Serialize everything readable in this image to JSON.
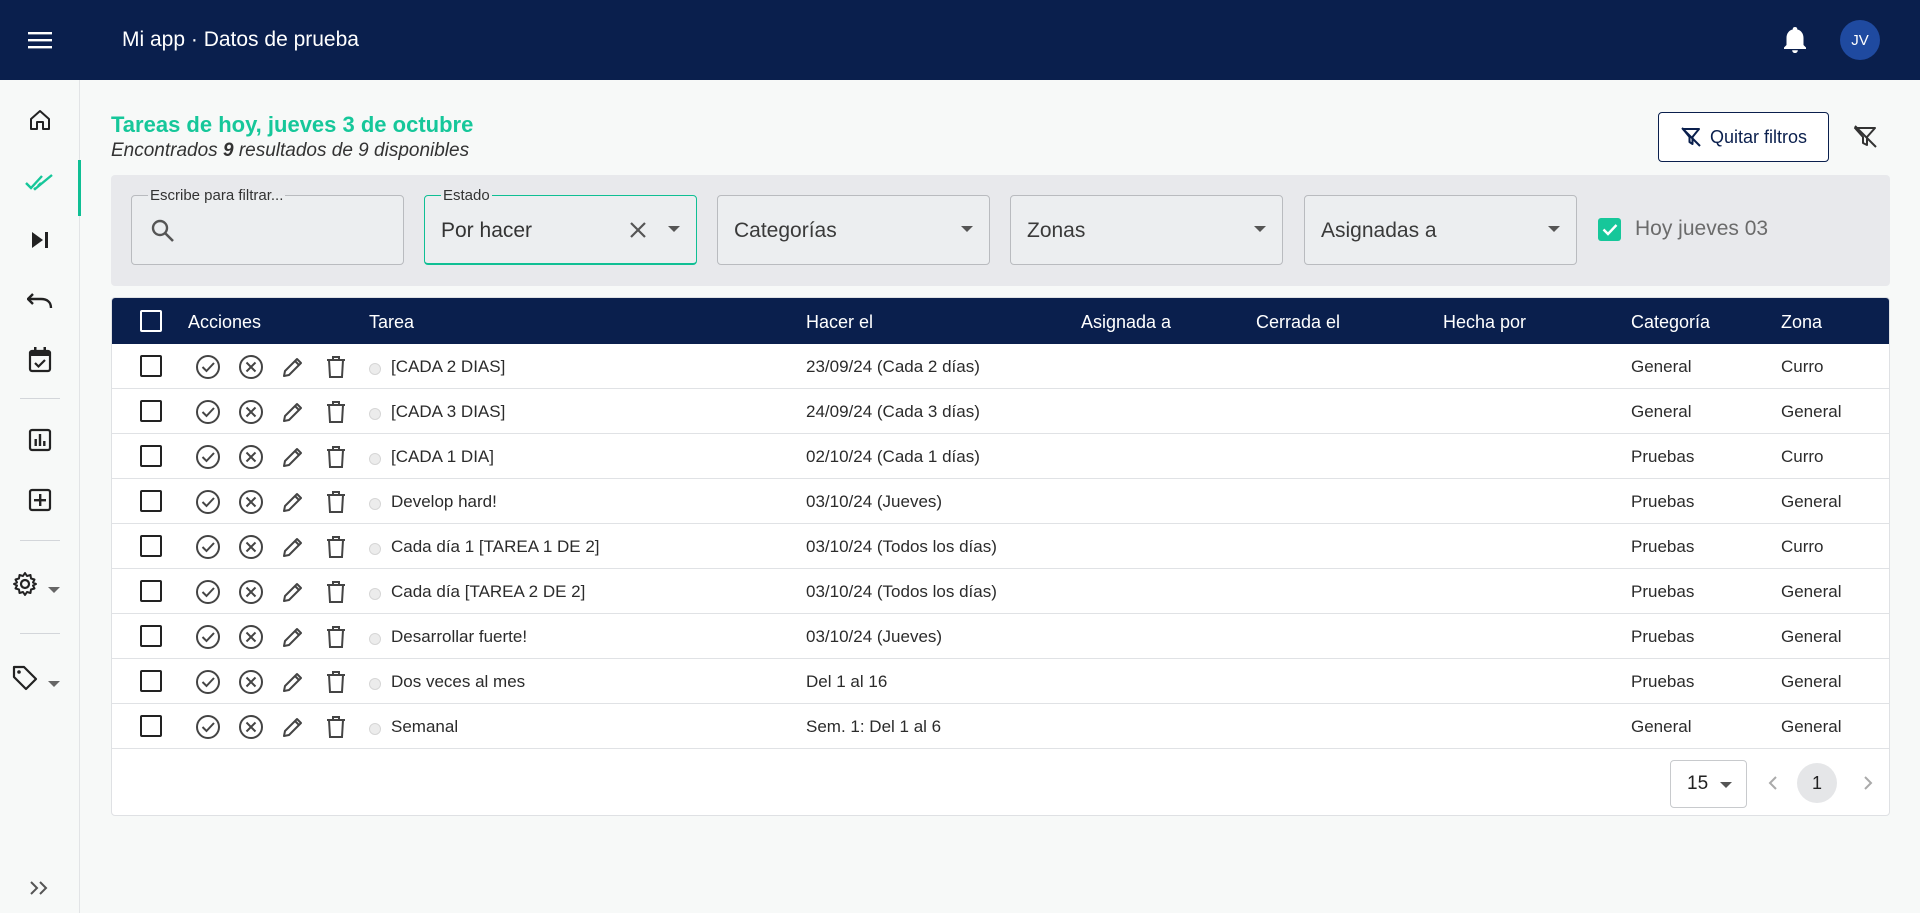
{
  "header": {
    "app_title": "Mi app · Datos de prueba",
    "avatar_initials": "JV",
    "menu_icon": "hamburger-icon",
    "notifications_icon": "bell-icon"
  },
  "sidebar": {
    "items": [
      {
        "icon": "home-icon"
      },
      {
        "icon": "double-check-icon",
        "active": true
      },
      {
        "icon": "skip-next-icon"
      },
      {
        "icon": "undo-icon"
      },
      {
        "icon": "calendar-check-icon"
      },
      {
        "icon": "bar-chart-icon"
      },
      {
        "icon": "add-box-icon"
      },
      {
        "icon": "gear-icon"
      },
      {
        "icon": "tag-icon"
      }
    ],
    "expand_icon": "double-chevron-right-icon"
  },
  "page": {
    "title": "Tareas de hoy, jueves 3 de octubre",
    "subtitle_prefix": "Encontrados",
    "subtitle_count": "9",
    "subtitle_suffix": "resultados de 9 disponibles",
    "clear_filters_label": "Quitar filtros"
  },
  "filters": {
    "search_label": "Escribe para filtrar...",
    "search_value": "",
    "estado_label": "Estado",
    "estado_value": "Por hacer",
    "categorias_placeholder": "Categorías",
    "zonas_placeholder": "Zonas",
    "asignadas_placeholder": "Asignadas a",
    "hoy_label": "Hoy jueves 03",
    "hoy_checked": true
  },
  "table": {
    "columns": [
      "Acciones",
      "Tarea",
      "Hacer el",
      "Asignada a",
      "Cerrada el",
      "Hecha por",
      "Categoría",
      "Zona"
    ],
    "rows": [
      {
        "tarea": "[CADA 2 DIAS]",
        "hacer_el": "23/09/24 (Cada 2 días)",
        "asignada": "",
        "cerrada": "",
        "hecha_por": "",
        "categoria": "General",
        "zona": "Curro"
      },
      {
        "tarea": "[CADA 3 DIAS]",
        "hacer_el": "24/09/24 (Cada 3 días)",
        "asignada": "",
        "cerrada": "",
        "hecha_por": "",
        "categoria": "General",
        "zona": "General"
      },
      {
        "tarea": "[CADA 1 DIA]",
        "hacer_el": "02/10/24 (Cada 1 días)",
        "asignada": "",
        "cerrada": "",
        "hecha_por": "",
        "categoria": "Pruebas",
        "zona": "Curro"
      },
      {
        "tarea": "Develop hard!",
        "hacer_el": "03/10/24 (Jueves)",
        "asignada": "",
        "cerrada": "",
        "hecha_por": "",
        "categoria": "Pruebas",
        "zona": "General"
      },
      {
        "tarea": "Cada día 1 [TAREA 1 DE 2]",
        "hacer_el": "03/10/24 (Todos los días)",
        "asignada": "",
        "cerrada": "",
        "hecha_por": "",
        "categoria": "Pruebas",
        "zona": "Curro"
      },
      {
        "tarea": "Cada día [TAREA 2 DE 2]",
        "hacer_el": "03/10/24 (Todos los días)",
        "asignada": "",
        "cerrada": "",
        "hecha_por": "",
        "categoria": "Pruebas",
        "zona": "General"
      },
      {
        "tarea": "Desarrollar fuerte!",
        "hacer_el": "03/10/24 (Jueves)",
        "asignada": "",
        "cerrada": "",
        "hecha_por": "",
        "categoria": "Pruebas",
        "zona": "General"
      },
      {
        "tarea": "Dos veces al mes",
        "hacer_el": "Del 1 al 16",
        "asignada": "",
        "cerrada": "",
        "hecha_por": "",
        "categoria": "Pruebas",
        "zona": "General"
      },
      {
        "tarea": "Semanal",
        "hacer_el": "Sem. 1: Del 1 al 6",
        "asignada": "",
        "cerrada": "",
        "hecha_por": "",
        "categoria": "General",
        "zona": "General"
      }
    ],
    "action_icons": [
      "check-circle-icon",
      "cancel-circle-icon",
      "pencil-icon",
      "trash-icon"
    ]
  },
  "pagination": {
    "page_size": "15",
    "current_page": "1"
  },
  "colors": {
    "header_bg": "#0a1f4d",
    "accent": "#16c79a"
  }
}
